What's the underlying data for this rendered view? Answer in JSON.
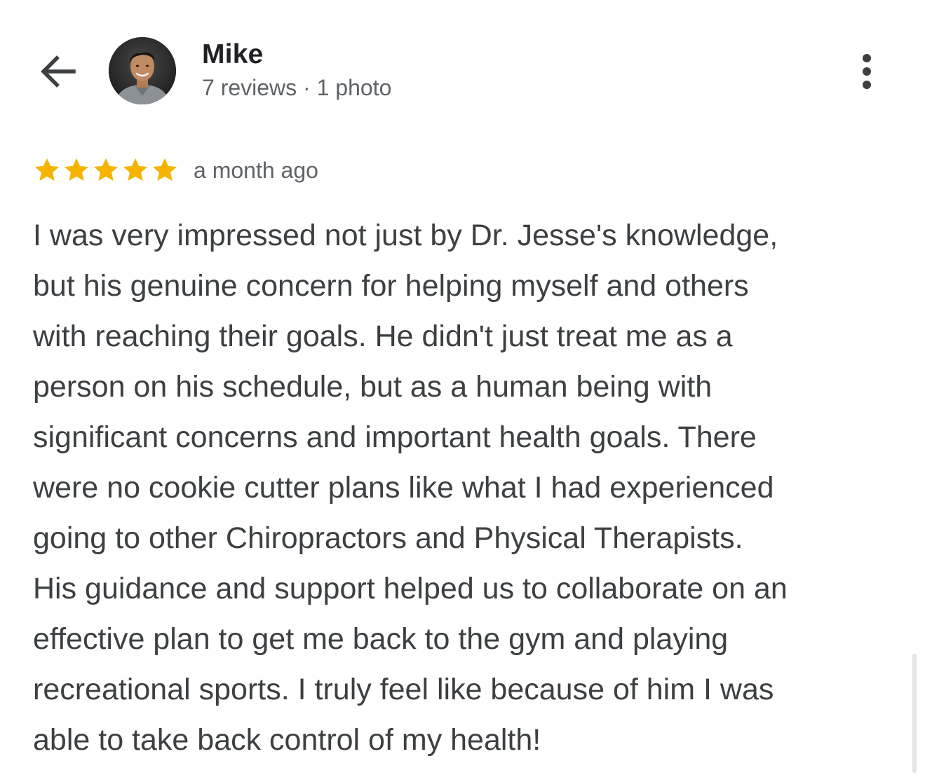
{
  "header": {
    "back_icon": "arrow-left-icon",
    "user": {
      "name": "Mike",
      "meta": "7 reviews · 1 photo",
      "avatar": "avatar-photo"
    },
    "more_icon": "more-vert-icon"
  },
  "review": {
    "rating": 5,
    "rating_max": 5,
    "star_color": "#f4b400",
    "date": "a month ago",
    "lines": [
      "I was very impressed not just by Dr. Jesse's knowledge,",
      "but his genuine concern for helping myself and others",
      "with reaching their goals. He didn't just treat me as a",
      "person on his schedule, but as a human being with",
      "significant concerns and important health goals. There",
      "were no cookie cutter plans like what I had experienced",
      "going to other Chiropractors and Physical Therapists.",
      "His guidance and support helped us to collaborate on an",
      "effective plan to get me back to the gym and playing",
      "recreational sports. I truly feel like because of him I was",
      "able to take back control of my health!"
    ]
  },
  "colors": {
    "text_primary": "#202124",
    "text_body": "#3c4043",
    "text_secondary": "#5f6368",
    "star": "#f4b400"
  }
}
